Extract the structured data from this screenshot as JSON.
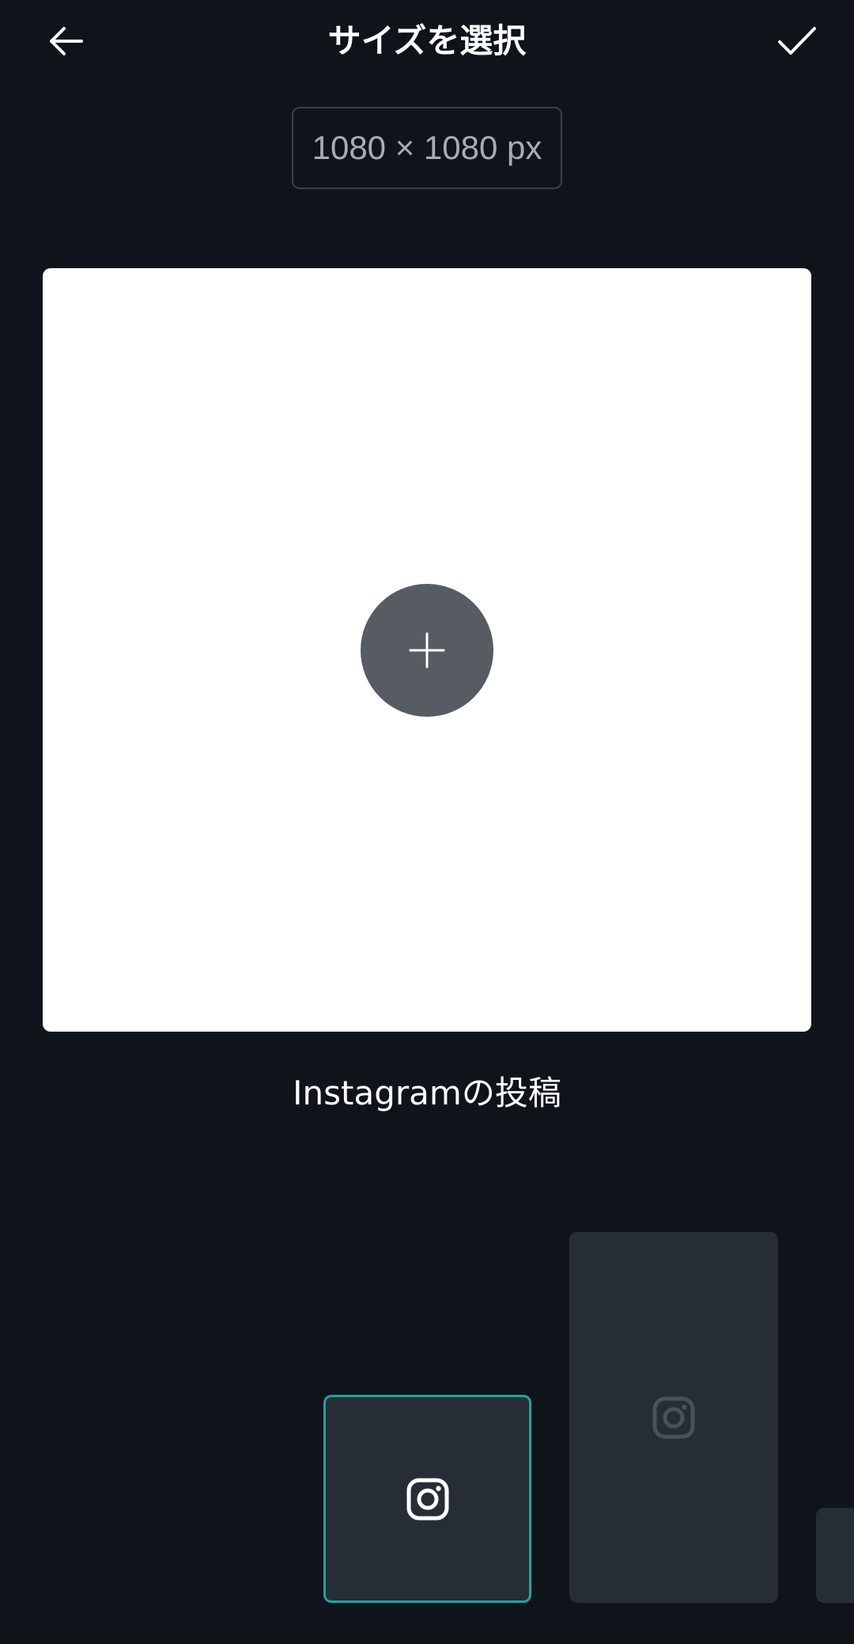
{
  "header": {
    "title": "サイズを選択",
    "back_icon": "arrow-left-icon",
    "confirm_icon": "checkmark-icon"
  },
  "size_display": {
    "value": "1080 × 1080 px"
  },
  "canvas": {
    "add_icon": "plus-icon",
    "background": "#ffffff"
  },
  "preset_label": "Instagramの投稿",
  "presets": [
    {
      "icon": "instagram-icon",
      "selected": true
    },
    {
      "icon": "instagram-icon",
      "selected": false
    },
    {
      "icon": "instagram-icon",
      "selected": false
    }
  ],
  "colors": {
    "background": "#0f141a",
    "tile": "#272d37",
    "selected_border": "#1ba5a5",
    "add_button": "#575b62"
  }
}
